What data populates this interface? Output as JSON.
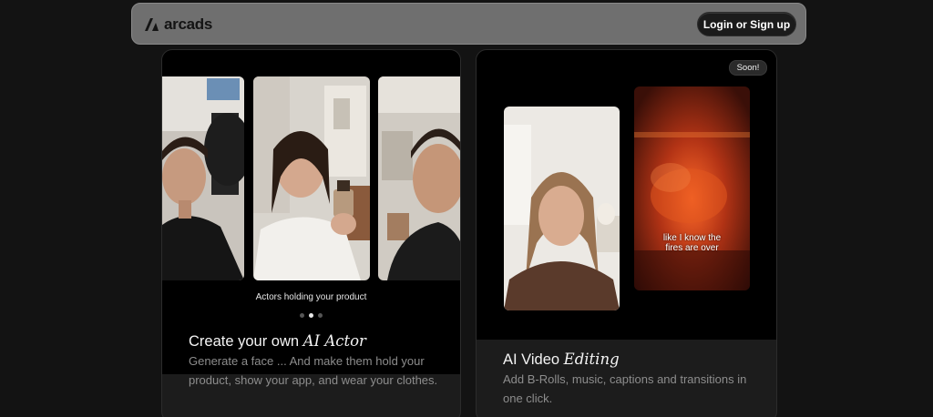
{
  "header": {
    "logo_text": "arcads",
    "login_label": "Login or Sign up"
  },
  "card_actor": {
    "caption": "Actors holding your product",
    "carousel": {
      "total": 3,
      "active": 2
    },
    "title_plain": "Create your own ",
    "title_italic": "AI Actor",
    "description": "Generate a face ... And make them hold your product, show your app, and wear your clothes."
  },
  "card_editing": {
    "badge": "Soon!",
    "subtitle_line1": "like I know the",
    "subtitle_line2": "fires are over",
    "title_plain": "AI Video ",
    "title_italic": "Editing",
    "description": "Add B-Rolls, music, captions and transitions in one click."
  },
  "colors": {
    "background": "#131313",
    "navbar": "#6f6f6f",
    "card": "#1c1c1c",
    "muted_text": "#8d8d8d"
  }
}
